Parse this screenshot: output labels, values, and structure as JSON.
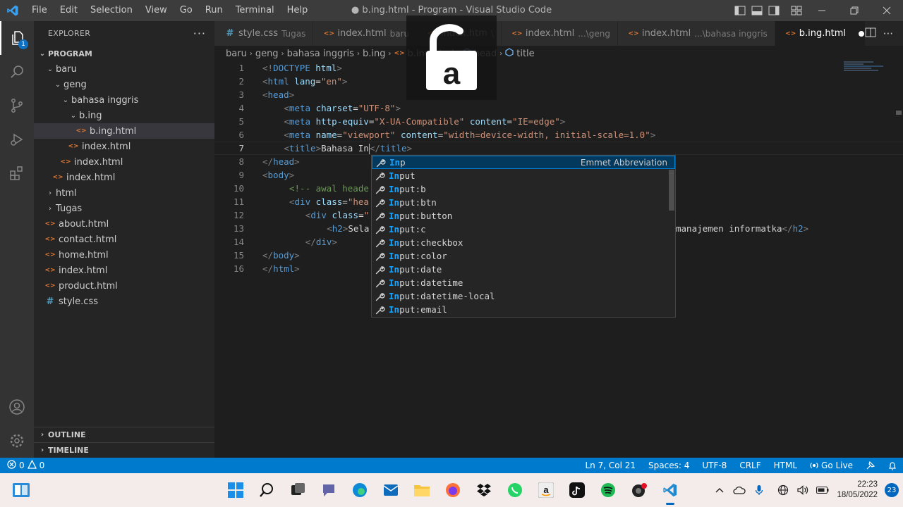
{
  "titlebar": {
    "menu": [
      "File",
      "Edit",
      "Selection",
      "View",
      "Go",
      "Run",
      "Terminal",
      "Help"
    ],
    "window_title": "● b.ing.html - Program - Visual Studio Code"
  },
  "explorer": {
    "title": "EXPLORER",
    "root": "PROGRAM",
    "tree": [
      {
        "label": "baru",
        "depth": 1,
        "type": "folder",
        "open": true
      },
      {
        "label": "geng",
        "depth": 2,
        "type": "folder",
        "open": true
      },
      {
        "label": "bahasa inggris",
        "depth": 3,
        "type": "folder",
        "open": true
      },
      {
        "label": "b.ing",
        "depth": 4,
        "type": "folder",
        "open": true
      },
      {
        "label": "b.ing.html",
        "depth": 5,
        "type": "html",
        "selected": true
      },
      {
        "label": "index.html",
        "depth": 4,
        "type": "html"
      },
      {
        "label": "index.html",
        "depth": 3,
        "type": "html"
      },
      {
        "label": "index.html",
        "depth": 2,
        "type": "html"
      },
      {
        "label": "html",
        "depth": 1,
        "type": "folder",
        "open": false
      },
      {
        "label": "Tugas",
        "depth": 1,
        "type": "folder",
        "open": false
      },
      {
        "label": "about.html",
        "depth": 1,
        "type": "html"
      },
      {
        "label": "contact.html",
        "depth": 1,
        "type": "html"
      },
      {
        "label": "home.html",
        "depth": 1,
        "type": "html"
      },
      {
        "label": "index.html",
        "depth": 1,
        "type": "html"
      },
      {
        "label": "product.html",
        "depth": 1,
        "type": "html"
      },
      {
        "label": "style.css",
        "depth": 1,
        "type": "css"
      }
    ],
    "outline": "OUTLINE",
    "timeline": "TIMELINE"
  },
  "tabs": [
    {
      "label": "style.css",
      "desc": "Tugas",
      "type": "css"
    },
    {
      "label": "index.html",
      "desc": "baru",
      "type": "html"
    },
    {
      "label": "index.htm",
      "desc": "\\",
      "type": "html"
    },
    {
      "label": "index.html",
      "desc": "...\\geng",
      "type": "html"
    },
    {
      "label": "index.html",
      "desc": "...\\bahasa inggris",
      "type": "html"
    },
    {
      "label": "b.ing.html",
      "desc": "",
      "type": "html",
      "active": true
    }
  ],
  "breadcrumbs": [
    "baru",
    "geng",
    "bahasa inggris",
    "b.ing",
    "b.ing.html",
    "head",
    "title"
  ],
  "code_lines": [
    {
      "n": "1",
      "ind": 0,
      "html": "<span class='t-br'>&lt;!</span><span class='t-tag'>DOCTYPE</span> <span class='t-attr'>html</span><span class='t-br'>&gt;</span>"
    },
    {
      "n": "2",
      "ind": 0,
      "html": "<span class='t-br'>&lt;</span><span class='t-tag'>html</span> <span class='t-attr'>lang</span>=<span class='t-str'>\"en\"</span><span class='t-br'>&gt;</span>"
    },
    {
      "n": "3",
      "ind": 0,
      "html": "<span class='t-br'>&lt;</span><span class='t-tag'>head</span><span class='t-br'>&gt;</span>"
    },
    {
      "n": "4",
      "ind": 4,
      "html": "<span class='t-br'>&lt;</span><span class='t-tag'>meta</span> <span class='t-attr'>charset</span>=<span class='t-str'>\"UTF-8\"</span><span class='t-br'>&gt;</span>"
    },
    {
      "n": "5",
      "ind": 4,
      "html": "<span class='t-br'>&lt;</span><span class='t-tag'>meta</span> <span class='t-attr'>http-equiv</span>=<span class='t-str'>\"X-UA-Compatible\"</span> <span class='t-attr'>content</span>=<span class='t-str'>\"IE=edge\"</span><span class='t-br'>&gt;</span>"
    },
    {
      "n": "6",
      "ind": 4,
      "html": "<span class='t-br'>&lt;</span><span class='t-tag'>meta</span> <span class='t-attr'>name</span>=<span class='t-str'>\"viewport\"</span> <span class='t-attr'>content</span>=<span class='t-str'>\"width=device-width, initial-scale=1.0\"</span><span class='t-br'>&gt;</span>"
    },
    {
      "n": "7",
      "ind": 4,
      "html": "<span class='t-br'>&lt;</span><span class='t-tag'>title</span><span class='t-br'>&gt;</span><span class='t-txt'>Bahasa In</span><span class='cursor'></span><span class='t-br'>&lt;/</span><span class='t-tag'>title</span><span class='t-br'>&gt;</span>",
      "current": true
    },
    {
      "n": "8",
      "ind": 0,
      "html": "<span class='t-br'>&lt;/</span><span class='t-tag'>head</span><span class='t-br'>&gt;</span>"
    },
    {
      "n": "9",
      "ind": 0,
      "html": "<span class='t-br'>&lt;</span><span class='t-tag'>body</span><span class='t-br'>&gt;</span>"
    },
    {
      "n": "10",
      "ind": 5,
      "html": "<span class='t-cm'>&lt;!-- awal heade</span>"
    },
    {
      "n": "11",
      "ind": 5,
      "html": "<span class='t-br'>&lt;</span><span class='t-tag'>div</span> <span class='t-attr'>class</span>=<span class='t-str'>\"hea</span>"
    },
    {
      "n": "12",
      "ind": 8,
      "html": "<span class='t-br'>&lt;</span><span class='t-tag'>div</span> <span class='t-attr'>class</span>=<span class='t-str'>\"</span>"
    },
    {
      "n": "13",
      "ind": 12,
      "html": "<span class='t-br'>&lt;</span><span class='t-tag'>h2</span><span class='t-br'>&gt;</span><span class='t-txt'>Sela</span>",
      "tail": "<span class='t-txt'>manajemen informatka</span><span class='t-br'>&lt;/</span><span class='t-tag'>h2</span><span class='t-br'>&gt;</span>"
    },
    {
      "n": "14",
      "ind": 8,
      "html": "<span class='t-br'>&lt;/</span><span class='t-tag'>div</span><span class='t-br'>&gt;</span>"
    },
    {
      "n": "15",
      "ind": 0,
      "html": "<span class='t-br'>&lt;/</span><span class='t-tag'>body</span><span class='t-br'>&gt;</span>"
    },
    {
      "n": "16",
      "ind": 0,
      "html": "<span class='t-br'>&lt;/</span><span class='t-tag'>html</span><span class='t-br'>&gt;</span>"
    }
  ],
  "suggestions": {
    "detail": "Emmet Abbreviation",
    "items": [
      {
        "match": "In",
        "rest": "p"
      },
      {
        "match": "In",
        "rest": "put"
      },
      {
        "match": "In",
        "rest": "put:b"
      },
      {
        "match": "In",
        "rest": "put:btn"
      },
      {
        "match": "In",
        "rest": "put:button"
      },
      {
        "match": "In",
        "rest": "put:c"
      },
      {
        "match": "In",
        "rest": "put:checkbox"
      },
      {
        "match": "In",
        "rest": "put:color"
      },
      {
        "match": "In",
        "rest": "put:date"
      },
      {
        "match": "In",
        "rest": "put:datetime"
      },
      {
        "match": "In",
        "rest": "put:datetime-local"
      },
      {
        "match": "In",
        "rest": "put:email"
      }
    ]
  },
  "overlay": {
    "letter": "a"
  },
  "statusbar": {
    "errors": "0",
    "warnings": "0",
    "position": "Ln 7, Col 21",
    "spaces": "Spaces: 4",
    "encoding": "UTF-8",
    "eol": "CRLF",
    "language": "HTML",
    "golive": "Go Live"
  },
  "taskbar": {
    "time": "22:23",
    "date": "18/05/2022",
    "notifications": "23"
  }
}
